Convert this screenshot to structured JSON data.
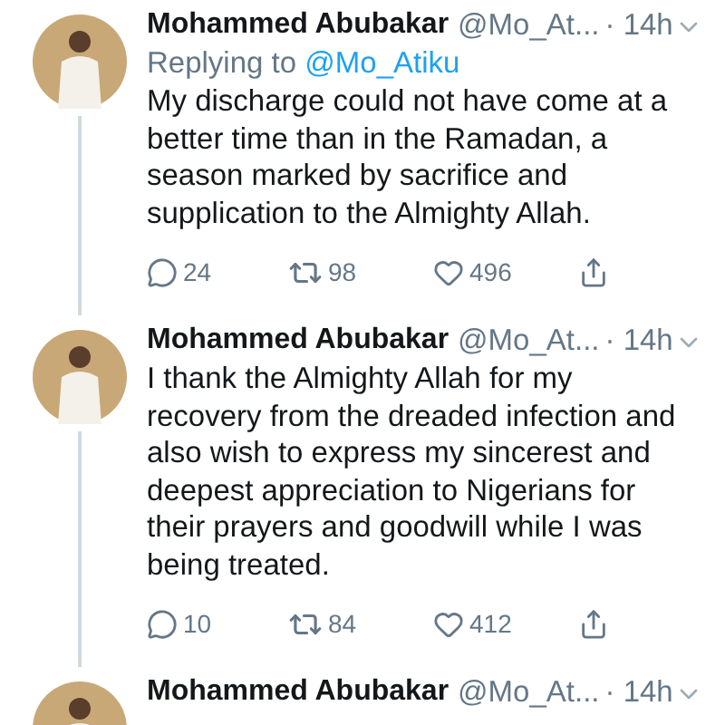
{
  "tweets": [
    {
      "name": "Mohammed Abubakar",
      "handle": "@Mo_At...",
      "time": "· 14h",
      "reply_label": "Replying to",
      "reply_to": "@Mo_Atiku",
      "text": "My discharge could not have come at a better time than in the Ramadan, a season marked by sacrifice and supplication to the Almighty Allah.",
      "replies": "24",
      "retweets": "98",
      "likes": "496",
      "thread_line": true
    },
    {
      "name": "Mohammed Abubakar",
      "handle": "@Mo_At...",
      "time": "· 14h",
      "text": "I thank the Almighty Allah for my recovery from the dreaded infection and also wish to express my sincerest and deepest appreciation to Nigerians for their prayers and goodwill while I was being treated.",
      "replies": "10",
      "retweets": "84",
      "likes": "412",
      "thread_line": true
    },
    {
      "name": "Mohammed Abubakar",
      "handle": "@Mo_At...",
      "time": "· 14h"
    }
  ]
}
